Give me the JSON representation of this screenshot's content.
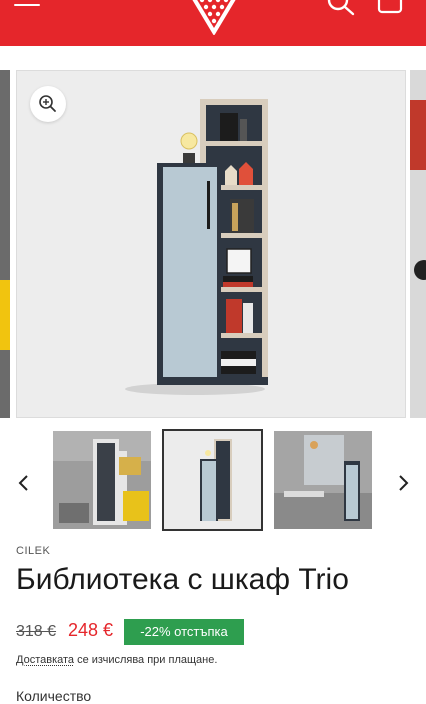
{
  "header": {
    "background": "#e5262b",
    "menu_icon": "hamburger-icon",
    "logo_icon": "strawberry-logo",
    "search_icon": "search-icon",
    "cart_icon": "bag-icon"
  },
  "gallery": {
    "zoom_icon": "zoom-in-icon",
    "prev_icon": "chevron-left-icon",
    "next_icon": "chevron-right-icon",
    "thumbnails": 3,
    "selected_thumbnail": 2
  },
  "product": {
    "brand": "CILEK",
    "title": "Библиотека с шкаф Trio",
    "old_price": "318 €",
    "price": "248 €",
    "discount_badge": "-22% отстъпка",
    "shipping_link": "Доставката",
    "shipping_text": " се изчислява при плащане.",
    "quantity_label": "Количество"
  },
  "colors": {
    "accent": "#e5262b",
    "discount": "#2e9e4f"
  }
}
